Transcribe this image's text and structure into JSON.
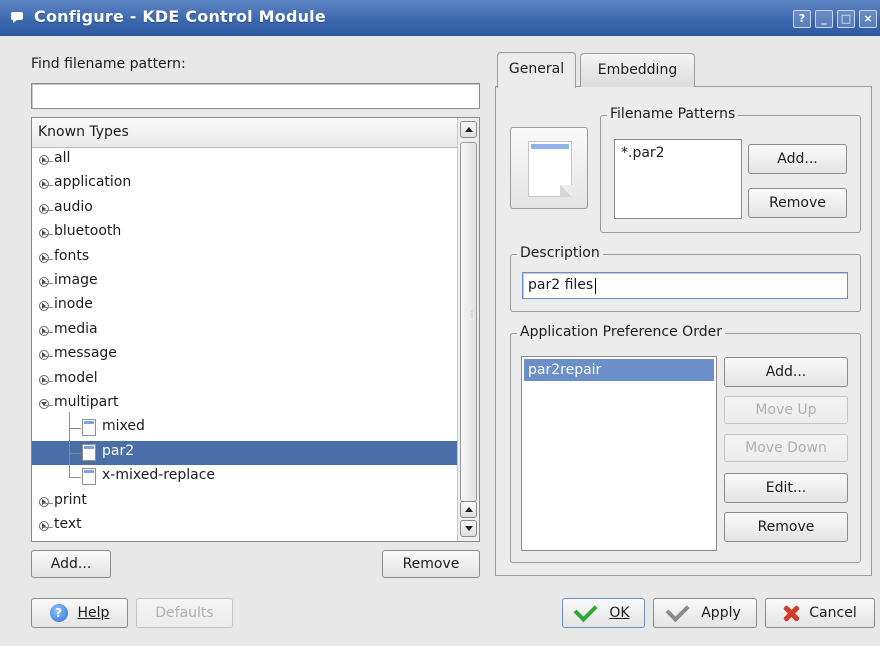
{
  "window": {
    "title": "Configure - KDE Control Module",
    "controls": [
      "?",
      "_",
      "□",
      "×"
    ]
  },
  "left": {
    "find_label": "Find filename pattern:",
    "find_value": "",
    "tree_header": "Known Types",
    "tree": [
      {
        "label": "all",
        "kind": "group",
        "open": false
      },
      {
        "label": "application",
        "kind": "group",
        "open": false
      },
      {
        "label": "audio",
        "kind": "group",
        "open": false
      },
      {
        "label": "bluetooth",
        "kind": "group",
        "open": false
      },
      {
        "label": "fonts",
        "kind": "group",
        "open": false
      },
      {
        "label": "image",
        "kind": "group",
        "open": false
      },
      {
        "label": "inode",
        "kind": "group",
        "open": false
      },
      {
        "label": "media",
        "kind": "group",
        "open": false
      },
      {
        "label": "message",
        "kind": "group",
        "open": false
      },
      {
        "label": "model",
        "kind": "group",
        "open": false
      },
      {
        "label": "multipart",
        "kind": "group",
        "open": true
      },
      {
        "label": "mixed",
        "kind": "child",
        "selected": false
      },
      {
        "label": "par2",
        "kind": "child",
        "selected": true
      },
      {
        "label": "x-mixed-replace",
        "kind": "child",
        "selected": false
      },
      {
        "label": "print",
        "kind": "group",
        "open": false
      },
      {
        "label": "text",
        "kind": "group",
        "open": false
      }
    ],
    "add_label": "Add...",
    "remove_label": "Remove"
  },
  "tabs": [
    {
      "label": "General",
      "active": true
    },
    {
      "label": "Embedding",
      "active": false
    }
  ],
  "general": {
    "filename_patterns": {
      "title": "Filename Patterns",
      "items": [
        "*.par2"
      ],
      "add_label": "Add...",
      "remove_label": "Remove"
    },
    "description": {
      "title": "Description",
      "value": "par2 files"
    },
    "app_pref": {
      "title": "Application Preference Order",
      "items": [
        "par2repair"
      ],
      "add_label": "Add...",
      "move_up_label": "Move Up",
      "move_down_label": "Move Down",
      "edit_label": "Edit...",
      "remove_label": "Remove"
    }
  },
  "bottom": {
    "help_label": "Help",
    "defaults_label": "Defaults",
    "ok_label": "OK",
    "apply_label": "Apply",
    "cancel_label": "Cancel"
  },
  "colors": {
    "titlebar": "#3a66ad",
    "selection": "#4a6fa8",
    "ok_green": "#2ea83a",
    "cancel_red": "#d33a2a"
  }
}
